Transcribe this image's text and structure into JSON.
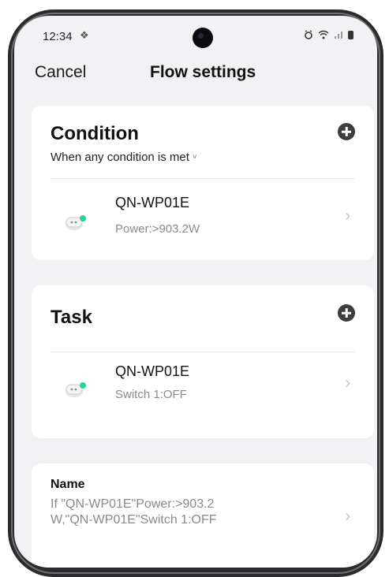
{
  "status_bar": {
    "time": "12:34",
    "vibrate_glyph": "❖"
  },
  "nav": {
    "cancel_label": "Cancel",
    "title": "Flow settings"
  },
  "condition_card": {
    "title": "Condition",
    "mode": "When any condition is met",
    "mode_caret": "˅",
    "items": [
      {
        "device": "QN-WP01E",
        "detail": "Power:>903.2W",
        "icon": "smart-plug-icon"
      }
    ]
  },
  "task_card": {
    "title": "Task",
    "items": [
      {
        "device": "QN-WP01E",
        "detail": "Switch 1:OFF",
        "icon": "smart-plug-icon"
      }
    ]
  },
  "name_card": {
    "label": "Name",
    "value": "If \"QN-WP01E\"Power:>903.2W,\"QN-WP01E\"Switch 1:OFF"
  },
  "icons": {
    "add": "plus-circle-icon",
    "chevron": "chevron-right-icon"
  },
  "colors": {
    "background": "#f2f2f4",
    "card": "#ffffff",
    "add_icon": "#3d3d3f",
    "device_led": "#2fcf9a"
  }
}
